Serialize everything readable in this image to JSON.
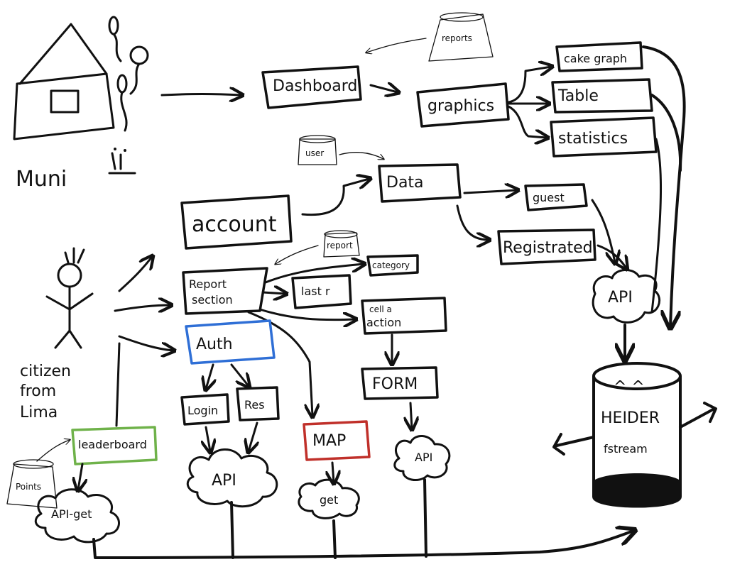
{
  "left": {
    "house_caption": "Muni",
    "citizen_caption": [
      "citizen",
      "from",
      "Lima"
    ]
  },
  "nodes": {
    "dashboard": "Dashboard",
    "graphics": "graphics",
    "cake_graph": "cake graph",
    "table": "Table",
    "statistics": "statistics",
    "data": "Data",
    "guest": "guest",
    "registrated": "Registrated",
    "account": "account",
    "report_section": [
      "Report",
      "section"
    ],
    "category": "category",
    "last_r": "last r",
    "cell_action": [
      "cell a",
      "action"
    ],
    "form": "FORM",
    "auth": "Auth",
    "login": "Login",
    "res": "Res",
    "map": "MAP",
    "leaderboard": "leaderboard"
  },
  "clouds": {
    "api_right": "API",
    "api_auth": "API",
    "get_map": "get",
    "api_form": "API",
    "api_get": "API-get"
  },
  "db_labels": {
    "reports": "reports",
    "user": "user",
    "report": "report",
    "points": "Points"
  },
  "server": {
    "eyes": "^ ^",
    "name": "HEIDER",
    "sub": "fstream"
  },
  "colors": {
    "auth_border": "#2f6fd6",
    "map_border": "#c0302a",
    "leaderboard_border": "#6fb24a",
    "ink": "#111111"
  }
}
